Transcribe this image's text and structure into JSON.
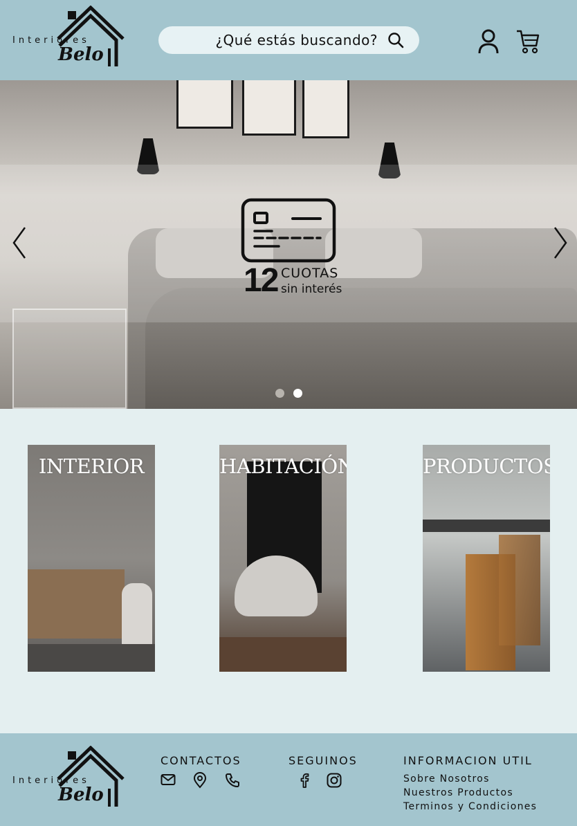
{
  "header": {
    "logo": {
      "small_text": "Interiores",
      "big_text": "Belo"
    },
    "search": {
      "placeholder": "¿Qué estás buscando?"
    },
    "icons": [
      "user-icon",
      "cart-icon"
    ]
  },
  "hero": {
    "promo": {
      "number": "12",
      "cuotas": "CUOTAS",
      "sin_interes": "sin interés"
    },
    "slides_total": 2,
    "active_slide": 2
  },
  "categories": [
    {
      "label": "INTERIOR"
    },
    {
      "label": "HABITACIÓN"
    },
    {
      "label": "PRODUCTOS"
    }
  ],
  "footer": {
    "logo": {
      "small_text": "Interiores",
      "big_text": "Belo"
    },
    "contactos": {
      "title": "CONTACTOS",
      "icons": [
        "mail-icon",
        "location-icon",
        "phone-icon"
      ]
    },
    "seguinos": {
      "title": "SEGUINOS",
      "icons": [
        "facebook-icon",
        "instagram-icon"
      ]
    },
    "info": {
      "title": "INFORMACION UTIL",
      "links": [
        "Sobre Nosotros",
        "Nuestros Productos",
        "Terminos y Condiciones"
      ]
    }
  },
  "colors": {
    "header_bg": "#a3c5ce",
    "page_bg": "#e4eff0",
    "search_bg": "#e7f2f4"
  }
}
